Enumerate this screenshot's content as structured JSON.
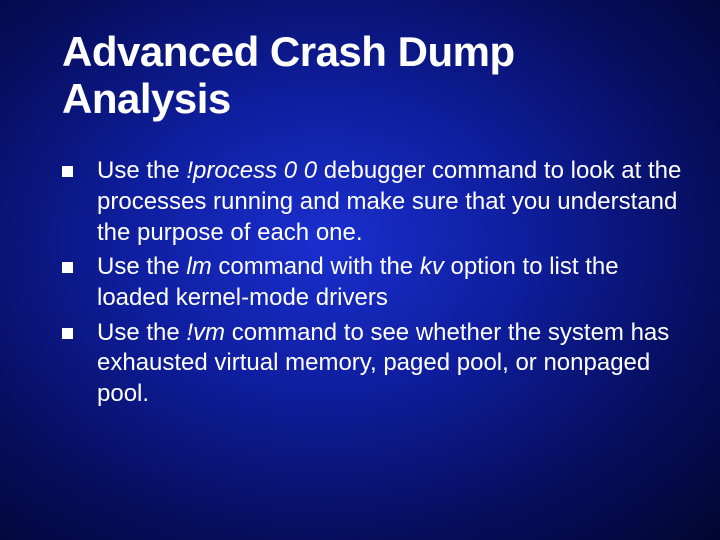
{
  "title": "Advanced Crash Dump Analysis",
  "bullets": [
    {
      "pre": "Use the ",
      "cmd": "!process 0 0",
      "post": " debugger command to look at the processes running and make sure that you understand the purpose of each one."
    },
    {
      "pre": "Use the ",
      "cmd": "lm",
      "mid": " command with the ",
      "cmd2": "kv",
      "post": " option to list the loaded kernel-mode drivers"
    },
    {
      "pre": "Use the ",
      "cmd": "!vm",
      "post": " command to see whether the system has exhausted virtual memory, paged pool, or nonpaged pool."
    }
  ]
}
